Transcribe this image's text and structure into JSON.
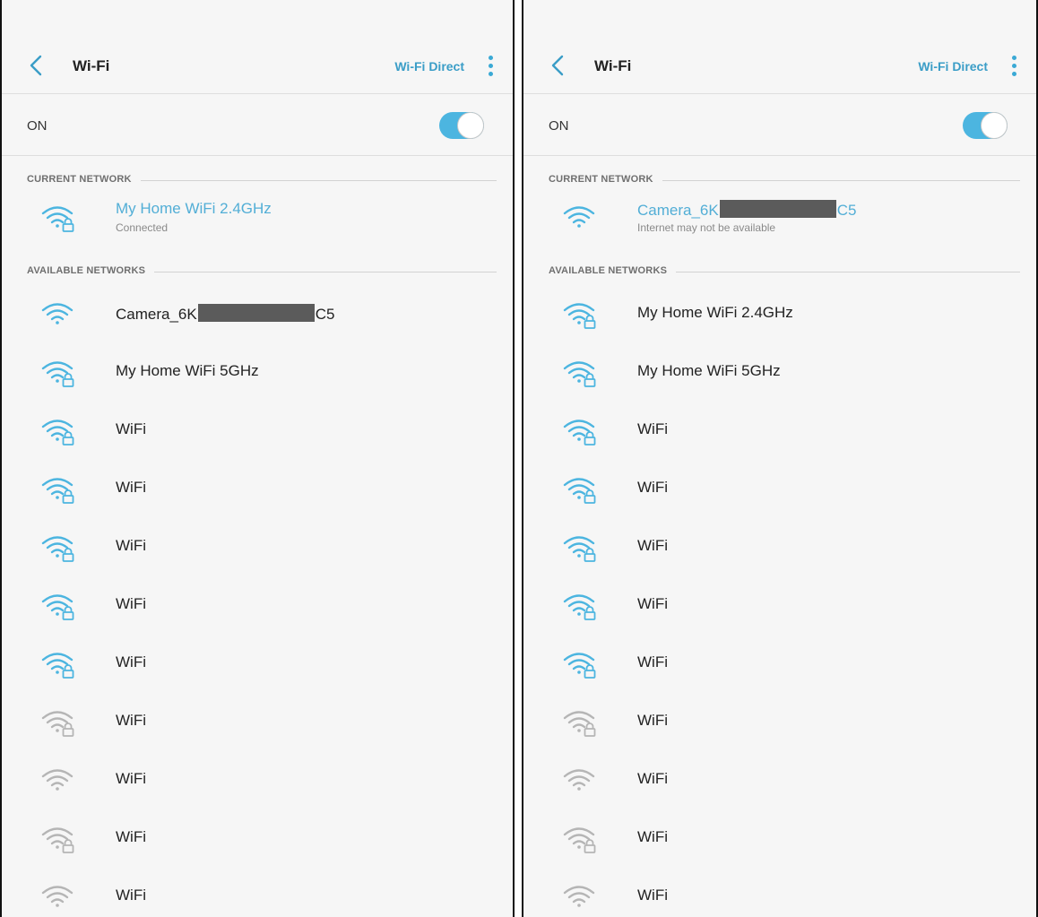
{
  "colors": {
    "accent": "#3a9dc7",
    "toggle_on": "#4cb5e0",
    "strong_signal": "#4cb5e0",
    "weak_signal": "#b5b5b5",
    "redaction": "#5b5b5b"
  },
  "panels": [
    {
      "header": {
        "title": "Wi-Fi",
        "wifi_direct": "Wi-Fi Direct"
      },
      "toggle_label": "ON",
      "toggle_on": true,
      "current_header": "CURRENT NETWORK",
      "current": {
        "name_prefix": "My Home WiFi 2.4GHz",
        "name_suffix": "",
        "status": "Connected",
        "redacted": false,
        "secured": true,
        "signal": "strong"
      },
      "available_header": "AVAILABLE NETWORKS",
      "networks": [
        {
          "name_prefix": "Camera_6K",
          "name_suffix": "C5",
          "redacted": true,
          "secured": false,
          "signal": "strong"
        },
        {
          "name_prefix": "My Home WiFi 5GHz",
          "name_suffix": "",
          "redacted": false,
          "secured": true,
          "signal": "strong"
        },
        {
          "name_prefix": "WiFi",
          "name_suffix": "",
          "redacted": false,
          "secured": true,
          "signal": "strong"
        },
        {
          "name_prefix": "WiFi",
          "name_suffix": "",
          "redacted": false,
          "secured": true,
          "signal": "strong"
        },
        {
          "name_prefix": "WiFi",
          "name_suffix": "",
          "redacted": false,
          "secured": true,
          "signal": "strong"
        },
        {
          "name_prefix": "WiFi",
          "name_suffix": "",
          "redacted": false,
          "secured": true,
          "signal": "strong"
        },
        {
          "name_prefix": "WiFi",
          "name_suffix": "",
          "redacted": false,
          "secured": true,
          "signal": "strong"
        },
        {
          "name_prefix": "WiFi",
          "name_suffix": "",
          "redacted": false,
          "secured": true,
          "signal": "weak"
        },
        {
          "name_prefix": "WiFi",
          "name_suffix": "",
          "redacted": false,
          "secured": false,
          "signal": "weak"
        },
        {
          "name_prefix": "WiFi",
          "name_suffix": "",
          "redacted": false,
          "secured": true,
          "signal": "weak"
        },
        {
          "name_prefix": "WiFi",
          "name_suffix": "",
          "redacted": false,
          "secured": false,
          "signal": "weak"
        }
      ]
    },
    {
      "header": {
        "title": "Wi-Fi",
        "wifi_direct": "Wi-Fi Direct"
      },
      "toggle_label": "ON",
      "toggle_on": true,
      "current_header": "CURRENT NETWORK",
      "current": {
        "name_prefix": "Camera_6K",
        "name_suffix": "C5",
        "status": "Internet may not be available",
        "redacted": true,
        "secured": false,
        "signal": "strong"
      },
      "available_header": "AVAILABLE NETWORKS",
      "networks": [
        {
          "name_prefix": "My Home WiFi 2.4GHz",
          "name_suffix": "",
          "redacted": false,
          "secured": true,
          "signal": "strong"
        },
        {
          "name_prefix": "My Home WiFi 5GHz",
          "name_suffix": "",
          "redacted": false,
          "secured": true,
          "signal": "strong"
        },
        {
          "name_prefix": "WiFi",
          "name_suffix": "",
          "redacted": false,
          "secured": true,
          "signal": "strong"
        },
        {
          "name_prefix": "WiFi",
          "name_suffix": "",
          "redacted": false,
          "secured": true,
          "signal": "strong"
        },
        {
          "name_prefix": "WiFi",
          "name_suffix": "",
          "redacted": false,
          "secured": true,
          "signal": "strong"
        },
        {
          "name_prefix": "WiFi",
          "name_suffix": "",
          "redacted": false,
          "secured": true,
          "signal": "strong"
        },
        {
          "name_prefix": "WiFi",
          "name_suffix": "",
          "redacted": false,
          "secured": true,
          "signal": "strong"
        },
        {
          "name_prefix": "WiFi",
          "name_suffix": "",
          "redacted": false,
          "secured": true,
          "signal": "weak"
        },
        {
          "name_prefix": "WiFi",
          "name_suffix": "",
          "redacted": false,
          "secured": false,
          "signal": "weak"
        },
        {
          "name_prefix": "WiFi",
          "name_suffix": "",
          "redacted": false,
          "secured": true,
          "signal": "weak"
        },
        {
          "name_prefix": "WiFi",
          "name_suffix": "",
          "redacted": false,
          "secured": false,
          "signal": "weak"
        }
      ]
    }
  ]
}
